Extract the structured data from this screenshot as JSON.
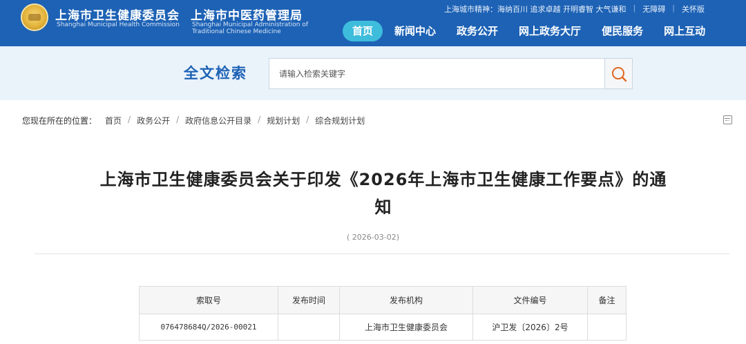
{
  "header": {
    "org_cn_1": "上海市卫生健康委员会",
    "org_en_1": "Shanghai Municipal Health Commission",
    "org_cn_2": "上海市中医药管理局",
    "org_en_2": "Shanghai Municipal Administration of Traditional Chinese Medicine",
    "city_spirit": "上海城市精神：海纳百川 追求卓越 开明睿智 大气谦和",
    "accessibility": "无障碍",
    "elderly_mode": "关怀版",
    "nav": [
      {
        "label": "首页",
        "active": true
      },
      {
        "label": "新闻中心",
        "active": false
      },
      {
        "label": "政务公开",
        "active": false
      },
      {
        "label": "网上政务大厅",
        "active": false
      },
      {
        "label": "便民服务",
        "active": false
      },
      {
        "label": "网上互动",
        "active": false
      }
    ],
    "brand_color": "#1d62b5",
    "active_nav_color": "#3dbcdc"
  },
  "search": {
    "title": "全文检索",
    "placeholder": "请输入检索关键字",
    "button_icon": "search-icon"
  },
  "breadcrumb": {
    "lead": "您现在所在的位置：",
    "items": [
      "首页",
      "政务公开",
      "政府信息公开目录",
      "规划计划",
      "综合规划计划"
    ]
  },
  "article": {
    "title": "上海市卫生健康委员会关于印发《2026年上海市卫生健康工作要点》的通知",
    "date": "( 2026-03-02)"
  },
  "info_table": {
    "headers": [
      "索取号",
      "发布时间",
      "发布机构",
      "文件编号",
      "备注"
    ],
    "rows": [
      [
        "076478684Q/2026-00021",
        "",
        "上海市卫生健康委员会",
        "沪卫发〔2026〕2号",
        ""
      ]
    ]
  }
}
